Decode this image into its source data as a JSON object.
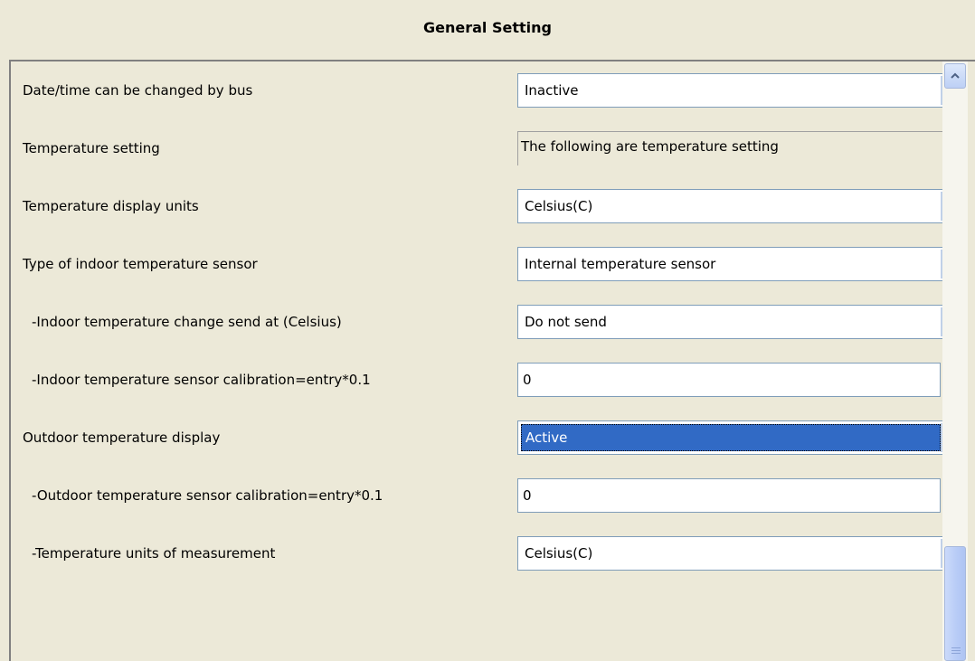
{
  "header": {
    "title": "General Setting"
  },
  "rows": [
    {
      "label": "Date/time can be changed by bus",
      "value": "Inactive",
      "kind": "select"
    },
    {
      "label": "Temperature setting",
      "value": "The following are temperature setting",
      "kind": "readonly"
    },
    {
      "label": "Temperature display units",
      "value": "Celsius(C)",
      "kind": "select"
    },
    {
      "label": "Type of indoor temperature sensor",
      "value": "Internal temperature sensor",
      "kind": "select"
    },
    {
      "label": "-Indoor temperature change send at (Celsius)",
      "value": "Do not send",
      "kind": "select"
    },
    {
      "label": "-Indoor temperature sensor calibration=entry*0.1",
      "value": "0",
      "kind": "input"
    },
    {
      "label": "Outdoor temperature display",
      "value": "Active",
      "kind": "select",
      "selected": true
    },
    {
      "label": "-Outdoor temperature sensor calibration=entry*0.1",
      "value": "0",
      "kind": "input"
    },
    {
      "label": "-Temperature units of measurement",
      "value": "Celsius(C)",
      "kind": "select"
    }
  ],
  "scrollbar": {
    "up_icon": "chevron-up-icon",
    "thumb_grip_icon": "grip-icon"
  },
  "colors": {
    "background": "#ECE9D8",
    "selection": "#316AC5",
    "field_border": "#7F9DB9"
  }
}
